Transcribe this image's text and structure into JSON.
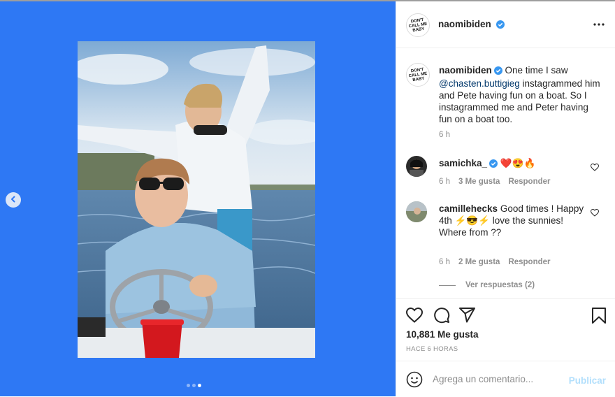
{
  "post": {
    "author": "naomibiden",
    "logo_text": [
      "DON'T",
      "CALL ME",
      "BABY"
    ]
  },
  "caption": {
    "author": "naomibiden",
    "text_before": "One time I saw",
    "mention": "@chasten.buttigieg",
    "text_after": "instagrammed him and Pete having fun on a boat. So I instagrammed me and Peter having fun on a boat too.",
    "time": "6 h"
  },
  "comments": [
    {
      "author": "samichka_",
      "verified": true,
      "text": "❤️😍🔥",
      "time": "6 h",
      "likes": "3 Me gusta",
      "reply": "Responder"
    },
    {
      "author": "camillehecks",
      "verified": false,
      "text": "Good times ! Happy 4th ⚡😎⚡ love the sunnies! Where from ??",
      "time": "6 h",
      "likes": "2 Me gusta",
      "reply": "Responder",
      "view_replies": "Ver respuestas (2)"
    }
  ],
  "likes_count": "10,881 Me gusta",
  "posted_ago": "HACE 6 HORAS",
  "comment_box": {
    "placeholder": "Agrega un comentario...",
    "publish": "Publicar"
  },
  "carousel": {
    "slides": 3,
    "active": 2
  },
  "colors": {
    "media_bg": "#2e78f4",
    "verified": "#3897f0",
    "link": "#00376b",
    "heart": "#ed4956"
  }
}
